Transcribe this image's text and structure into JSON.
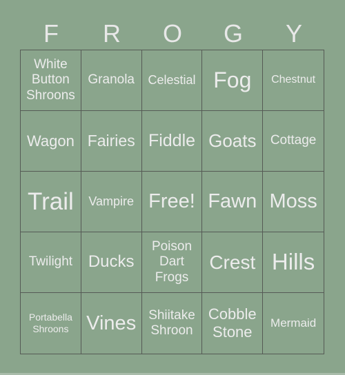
{
  "title_letters": [
    "F",
    "R",
    "O",
    "G",
    "Y"
  ],
  "colors": {
    "background": "#8aa58c",
    "text": "#ececec",
    "grid_lines": "#555a55"
  },
  "cells": [
    {
      "text": "White Button Shroons",
      "size": 19
    },
    {
      "text": "Granola",
      "size": 19
    },
    {
      "text": "Celestial",
      "size": 18
    },
    {
      "text": "Fog",
      "size": 32
    },
    {
      "text": "Chestnut",
      "size": 16
    },
    {
      "text": "Wagon",
      "size": 22
    },
    {
      "text": "Fairies",
      "size": 23
    },
    {
      "text": "Fiddle",
      "size": 25
    },
    {
      "text": "Goats",
      "size": 26
    },
    {
      "text": "Cottage",
      "size": 19
    },
    {
      "text": "Trail",
      "size": 35
    },
    {
      "text": "Vampire",
      "size": 18
    },
    {
      "text": "Free!",
      "size": 29
    },
    {
      "text": "Fawn",
      "size": 29
    },
    {
      "text": "Moss",
      "size": 29
    },
    {
      "text": "Twilight",
      "size": 19
    },
    {
      "text": "Ducks",
      "size": 24
    },
    {
      "text": "Poison Dart Frogs",
      "size": 19
    },
    {
      "text": "Crest",
      "size": 28
    },
    {
      "text": "Hills",
      "size": 33
    },
    {
      "text": "Portabella Shroons",
      "size": 14
    },
    {
      "text": "Vines",
      "size": 29
    },
    {
      "text": "Shiitake Shroon",
      "size": 19
    },
    {
      "text": "Cobble Stone",
      "size": 22
    },
    {
      "text": "Mermaid",
      "size": 17
    }
  ]
}
